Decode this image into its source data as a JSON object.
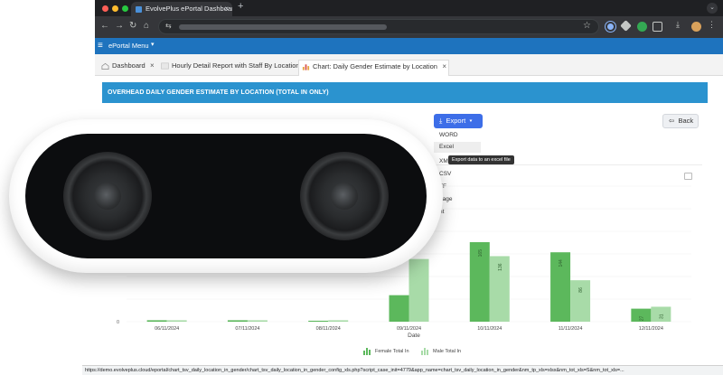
{
  "browser": {
    "tab_title": "EvolvePlus ePortal Dashboard",
    "colors": {
      "close": "#ff5f57",
      "minimize": "#febc2e",
      "maximize": "#28c840"
    }
  },
  "app": {
    "menu_label": "ePortal Menu",
    "tabs": [
      {
        "label": "Dashboard"
      },
      {
        "label": "Hourly Detail Report with Staff By Location"
      },
      {
        "label": "Chart: Daily Gender Estimate by Location"
      }
    ],
    "banner": "OVERHEAD DAILY GENDER ESTIMATE BY LOCATION (TOTAL IN ONLY)",
    "export_label": "Export",
    "back_label": "Back",
    "export_menu": [
      "WORD",
      "Excel",
      "XML",
      "CSV",
      "TXT",
      "Image",
      "Print"
    ],
    "export_menu_visible": [
      "WORD",
      "Excel",
      "XM",
      "CSV",
      "TF",
      "nage",
      "nt"
    ],
    "tooltip": "Export data to an excel file"
  },
  "chart_data": {
    "type": "bar",
    "xlabel": "Date",
    "categories": [
      "06/11/2024",
      "07/11/2024",
      "08/11/2024",
      "09/11/2024",
      "10/11/2024",
      "11/11/2024",
      "12/11/2024"
    ],
    "series": [
      {
        "name": "Female Total In",
        "color": "#5cb85c",
        "values": [
          3,
          3,
          2,
          55,
          165,
          144,
          27
        ]
      },
      {
        "name": "Male Total In",
        "color": "#a8dba8",
        "values": [
          3,
          3,
          3,
          130,
          136,
          86,
          31
        ]
      }
    ],
    "data_labels": [
      [
        null,
        null,
        null,
        null,
        "165",
        "144",
        "27"
      ],
      [
        null,
        null,
        null,
        null,
        "136",
        "86",
        "31"
      ]
    ],
    "ylim": [
      0,
      170
    ],
    "y_zero_label": "0",
    "legend": "bottom-center",
    "grid": true
  },
  "statusbar": {
    "url": "https://demo.evolveplus.cloud/eportal/chart_tsv_daily_location_in_gender/chart_tsv_daily_location_in_gender_config_xls.php?script_case_init=4779&app_name=chart_tsv_daily_location_in_gender&nm_tp_xls=xlsx&nm_tot_xls=S&nm_tot_xls=..."
  },
  "camera": {
    "icon": "stereo-camera-device"
  }
}
